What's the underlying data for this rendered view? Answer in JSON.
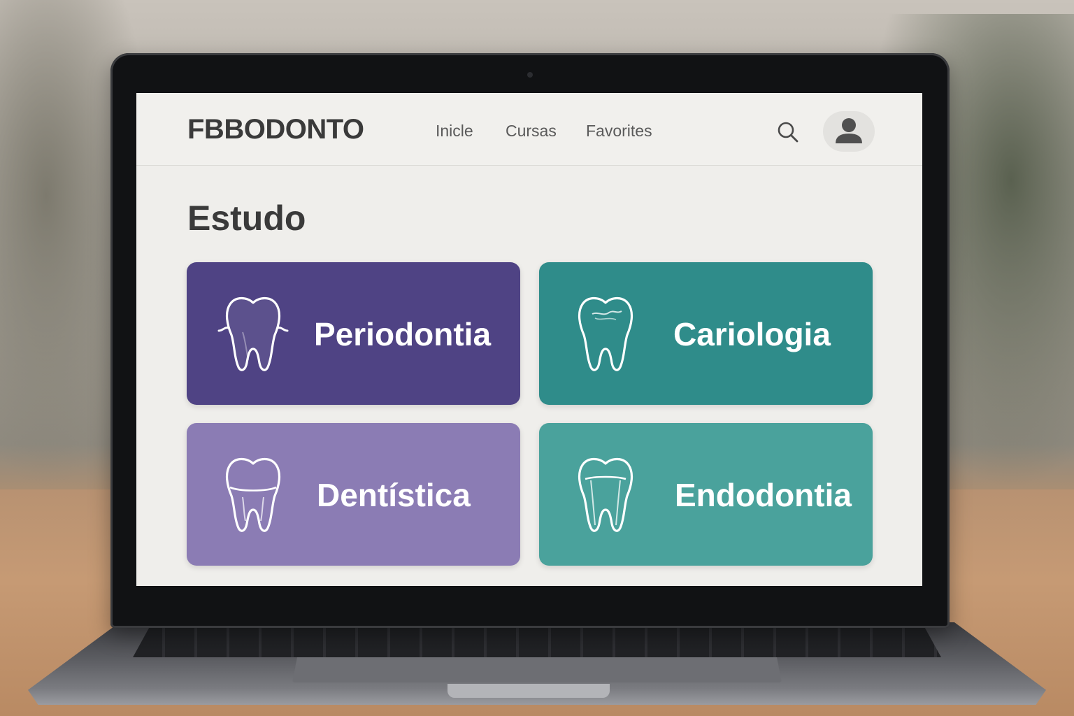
{
  "navbar": {
    "brand": "FBBODONTO",
    "links": [
      "Inicle",
      "Cursas",
      "Favorites"
    ],
    "search_icon": "search-icon",
    "profile_icon": "user-icon"
  },
  "main": {
    "title": "Estudo",
    "cards": [
      {
        "label": "Periodontia",
        "icon": "tooth-periodontia-icon",
        "color": "#4f4384"
      },
      {
        "label": "Cariologia",
        "icon": "tooth-cariologia-icon",
        "color": "#2f8c8a"
      },
      {
        "label": "Dentística",
        "icon": "tooth-dentistica-icon",
        "color": "#8b7cb4"
      },
      {
        "label": "Endodontia",
        "icon": "tooth-endodontia-icon",
        "color": "#4aa29c"
      }
    ]
  }
}
